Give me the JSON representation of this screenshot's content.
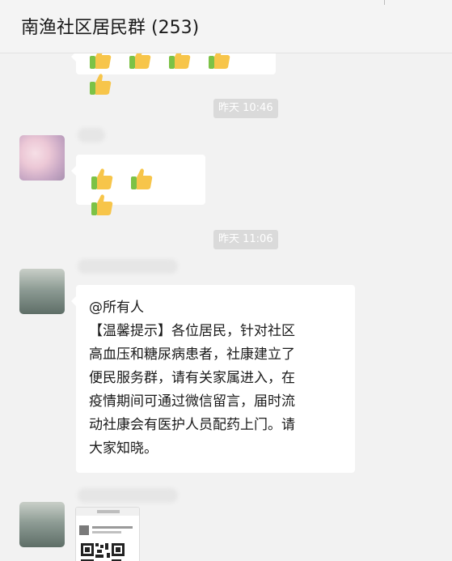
{
  "header": {
    "title": "南渔社区居民群 (253)"
  },
  "timestamps": [
    "昨天 10:46",
    "昨天 11:06"
  ],
  "messages": [
    {
      "type": "emoji",
      "emoji": [
        "thumbs-up",
        "thumbs-up",
        "thumbs-up"
      ]
    },
    {
      "type": "text",
      "mention": "@所有人",
      "body": "【温馨提示】各位居民，针对社区\n高血压和糖尿病患者，社康建立了\n便民服务群，请有关家属进入，在\n疫情期间可通过微信留言，届时流\n动社康会有医护人员配药上门。请\n大家知晓。"
    },
    {
      "type": "image-card"
    }
  ],
  "colors": {
    "background": "#f2f2f2",
    "bubble": "#ffffff",
    "time_pill": "#dadada",
    "thumb_yellow": "#f7c54a",
    "sleeve_green": "#7cc246"
  }
}
